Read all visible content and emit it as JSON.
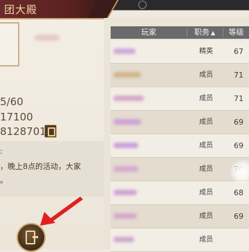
{
  "hall": {
    "title": "团大殿",
    "info_lines": [
      "5/60",
      "17100",
      "81287017"
    ],
    "notice_lines": [
      ":",
      "，晚上8点的活动，大家",
      "。"
    ]
  },
  "table": {
    "headers": {
      "player": "玩家",
      "role": "职务",
      "sort_icon": "▲",
      "level": "等级"
    },
    "rows": [
      {
        "role": "精英",
        "level": "67",
        "name_color": "#c9a9d8",
        "name_width": 32
      },
      {
        "role": "成员",
        "level": "71",
        "name_color": "#d2b48a",
        "name_width": 40
      },
      {
        "role": "成员",
        "level": "71",
        "name_color": "#d6a8c8",
        "name_width": 44
      },
      {
        "role": "成员",
        "level": "69",
        "name_color": "#cf9fd8",
        "name_width": 40
      },
      {
        "role": "成员",
        "level": "69",
        "name_color": "#c8a0dc",
        "name_width": 36
      },
      {
        "role": "成员",
        "level": "70",
        "name_color": "#d8a8d0",
        "name_width": 36
      },
      {
        "role": "成员",
        "level": "68",
        "name_color": "#d0a4d4",
        "name_width": 34
      },
      {
        "role": "成员",
        "level": "69",
        "name_color": "#d4a8cc",
        "name_width": 34
      },
      {
        "role": "成员",
        "level": "",
        "name_color": "#cfa8d2",
        "name_width": 30
      }
    ]
  },
  "icons": {
    "copy": "copy-icon",
    "exit": "exit-door-icon",
    "arrow": "red-arrow-annotation",
    "sort": "sort-up-icon"
  },
  "colors": {
    "header_red": "#6b2a2a",
    "gold": "#c9a66b",
    "table_header": "#6a6a6c",
    "arrow": "#e02020"
  }
}
